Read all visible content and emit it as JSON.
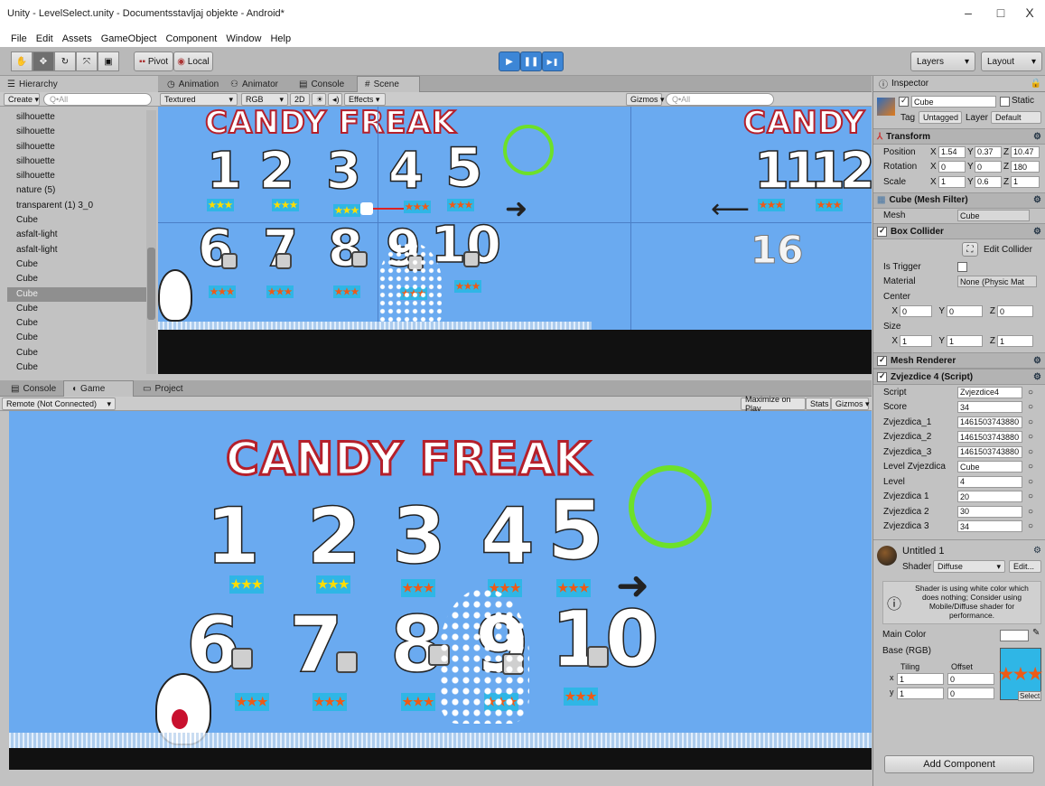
{
  "window": {
    "title": "Unity - LevelSelect.unity - Documentsstavljaj objekte - Android*",
    "minimize": "–",
    "maximize": "□",
    "close": "X"
  },
  "menu": [
    "File",
    "Edit",
    "Assets",
    "GameObject",
    "Component",
    "Window",
    "Help"
  ],
  "toolbar": {
    "pivot": "Pivot",
    "local": "Local",
    "layers": "Layers",
    "layout": "Layout",
    "play": "▶",
    "pause": "❚❚",
    "step": "▶❚"
  },
  "hierarchy": {
    "tab": "Hierarchy",
    "create": "Create",
    "search": "Q•All",
    "items": [
      "silhouette",
      "silhouette",
      "silhouette",
      "silhouette",
      "silhouette",
      "nature (5)",
      "transparent (1) 3_0",
      "Cube",
      "asfalt-light",
      "asfalt-light",
      "Cube",
      "Cube",
      "Cube",
      "Cube",
      "Cube",
      "Cube",
      "Cube",
      "Cube"
    ],
    "selected_index": 12
  },
  "scene": {
    "tabs": [
      "Animation",
      "Animator",
      "Console",
      "Scene"
    ],
    "active_tab": "Scene",
    "shading": "Textured",
    "rgb": "RGB",
    "mode2d": "2D",
    "effects": "Effects",
    "gizmos": "Gizmos",
    "search": "Q•All",
    "numbers_row1": [
      "1",
      "2",
      "3",
      "4",
      "5"
    ],
    "numbers_row2": [
      "6",
      "7",
      "8",
      "9",
      "10"
    ],
    "right_title": "CANDY",
    "right_numbers": [
      "11",
      "12"
    ],
    "right_number_16": "16",
    "arrow_right": "➜",
    "arrow_left": "⟵"
  },
  "bottom": {
    "tabs": [
      "Console",
      "Game",
      "Project"
    ],
    "active_tab": "Game",
    "remote": "Remote (Not Connected)",
    "maximize": "Maximize on Play",
    "stats": "Stats",
    "gizmos": "Gizmos"
  },
  "game": {
    "title": "CANDY FREAK",
    "numbers_row1": [
      "1",
      "2",
      "3",
      "4",
      "5"
    ],
    "numbers_row2": [
      "6",
      "7",
      "8",
      "9",
      "10"
    ],
    "star_glyph": "★★★",
    "arrow": "➜"
  },
  "inspector": {
    "tab": "Inspector",
    "object_name": "Cube",
    "static": "Static",
    "tag_label": "Tag",
    "tag": "Untagged",
    "layer_label": "Layer",
    "layer": "Default",
    "transform": {
      "title": "Transform",
      "position_label": "Position",
      "position": [
        "1.54",
        "0.37",
        "10.47"
      ],
      "rotation_label": "Rotation",
      "rotation": [
        "0",
        "0",
        "180"
      ],
      "scale_label": "Scale",
      "scale": [
        "1",
        "0.6",
        "1"
      ]
    },
    "mesh_filter": {
      "title": "Cube (Mesh Filter)",
      "mesh_label": "Mesh",
      "mesh": "Cube"
    },
    "box_collider": {
      "title": "Box Collider",
      "edit": "Edit Collider",
      "is_trigger": "Is Trigger",
      "material_label": "Material",
      "material": "None (Physic Mat",
      "center_label": "Center",
      "center": [
        "0",
        "0",
        "0"
      ],
      "size_label": "Size",
      "size": [
        "1",
        "1",
        "1"
      ]
    },
    "mesh_renderer": {
      "title": "Mesh Renderer"
    },
    "script": {
      "title": "Zvjezdice 4 (Script)",
      "rows": [
        {
          "label": "Script",
          "value": "Zvjezdice4"
        },
        {
          "label": "Score",
          "value": "34"
        },
        {
          "label": "Zvjezdica_1",
          "value": "1461503743880"
        },
        {
          "label": "Zvjezdica_2",
          "value": "1461503743880"
        },
        {
          "label": "Zvjezdica_3",
          "value": "1461503743880"
        },
        {
          "label": "Level Zvjezdica",
          "value": "Cube"
        },
        {
          "label": "Level",
          "value": "4"
        },
        {
          "label": "Zvjezdica 1",
          "value": "20"
        },
        {
          "label": "Zvjezdica 2",
          "value": "30"
        },
        {
          "label": "Zvjezdica 3",
          "value": "34"
        }
      ]
    },
    "material": {
      "name": "Untitled 1",
      "shader_label": "Shader",
      "shader": "Diffuse",
      "edit": "Edit...",
      "warning": "Shader is using white color which does nothing; Consider using Mobile/Diffuse shader for performance.",
      "main_color": "Main Color",
      "base": "Base (RGB)",
      "tiling": "Tiling",
      "offset": "Offset",
      "x_label": "x",
      "y_label": "y",
      "tiling_x": "1",
      "tiling_y": "1",
      "offset_x": "0",
      "offset_y": "0",
      "select": "Select"
    },
    "add_component": "Add Component"
  },
  "colors": {
    "sky": "#6aaaf0",
    "sun": "#6de029",
    "candy_stroke": "#b5202b",
    "selection": "#8f8f8f"
  }
}
